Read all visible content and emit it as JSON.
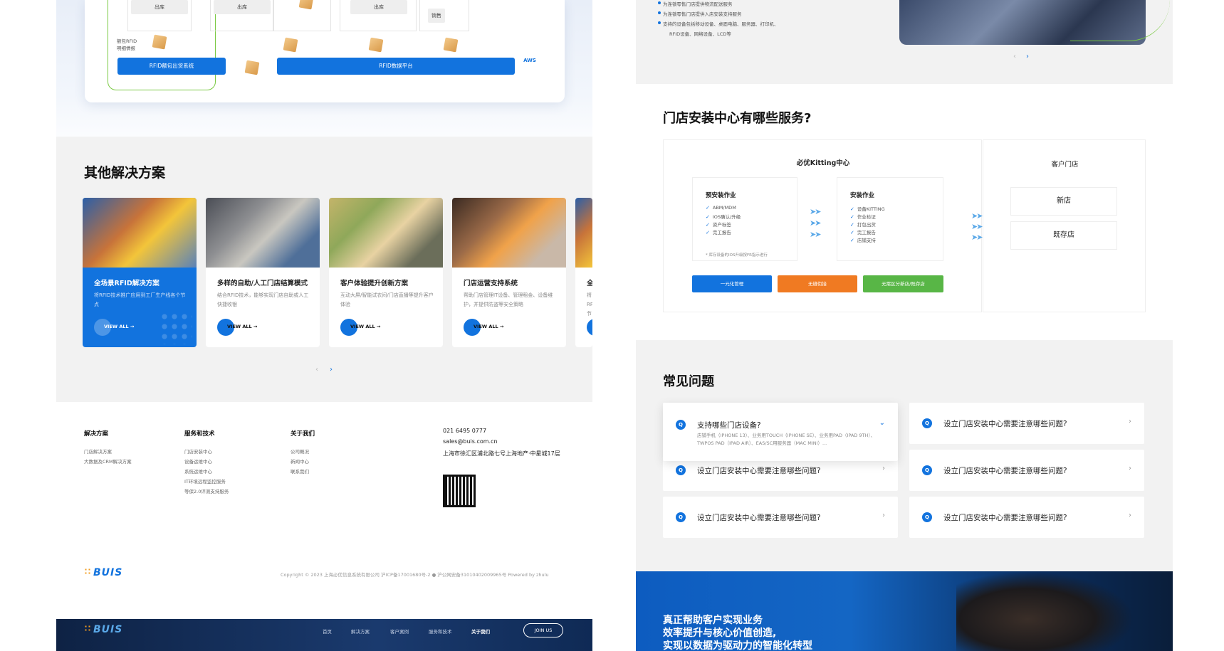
{
  "left": {
    "diagram": {
      "labels": [
        "出库",
        "出库",
        "出库",
        "销售"
      ],
      "side_note_1": "额包RFID",
      "side_note_2": "明细情报",
      "bar_left": "RFID额包出货系统",
      "bar_right": "RFID数据平台",
      "aws": "AWS"
    },
    "other_solutions": {
      "title": "其他解决方案",
      "view_all": "VIEW ALL",
      "prev": "‹",
      "next": "›",
      "cards": [
        {
          "title": "全场景RFID解决方案",
          "desc": "将RFID技术推广应用到工厂生产线各个节点"
        },
        {
          "title": "多样的自助/人工门店结算模式",
          "desc": "结合RFID技术，能够实现门店自助或人工快捷收银"
        },
        {
          "title": "客户体验提升创新方案",
          "desc": "互动大屏/智能试衣间/门店直播等提升客户体验"
        },
        {
          "title": "门店运营支持系统",
          "desc": "帮助门店管理IT设备、管理租金、设备维护，并提供防盗等安全策略"
        },
        {
          "title": "全",
          "desc": "将RFID节"
        }
      ]
    },
    "footer": {
      "col1": {
        "head": "解决方案",
        "items": [
          "门店解决方案",
          "大数据及CRM解决方案"
        ]
      },
      "col2": {
        "head": "服务和技术",
        "items": [
          "门店安装中心",
          "设备运维中心",
          "系统运维中心",
          "IT环境远程监控服务",
          "等保2.0评测支持服务"
        ]
      },
      "col3": {
        "head": "关于我们",
        "items": [
          "公司概况",
          "新闻中心",
          "联系我们"
        ]
      },
      "phone": "021 6495 0777",
      "email": "sales@buis.com.cn",
      "address": "上海市徐汇区浦北路七号上海地产·中星城17层",
      "logo": "BUIS",
      "copyright": "Copyright © 2023 上海必优信息系统有限公司 沪ICP备17001680号-2  ● 沪公网安备31010402009965号 Powered by zhulu"
    },
    "nav": {
      "logo": "BUIS",
      "items": [
        "首页",
        "解决方案",
        "客户案例",
        "服务和技术",
        "关于我们"
      ],
      "join": "JOIN US"
    }
  },
  "right": {
    "top_bullets": [
      "为连锁零售门店提供物流配送服务",
      "为连锁零售门店提供入店安装支持服务",
      "支持的设备包括移动设备、桌面电脑、服务器、打印机、",
      "RFID设备、网络设备、LCD等"
    ],
    "pager_prev": "‹",
    "pager_next": "›",
    "store_install": {
      "title": "门店安装中心有哪些服务?",
      "kitting_head": "必优Kitting中心",
      "pre_head": "预安装作业",
      "pre_items": [
        "ABM/MDM",
        "IOS确认/升级",
        "资产标签",
        "完工报告"
      ],
      "pre_note": "* 库存设备的IOS升级按FR指示进行",
      "install_head": "安装作业",
      "install_items": [
        "设备KITTING",
        "作业检证",
        "打包出货",
        "完工报告",
        "店铺支持"
      ],
      "btn1": "一元化管理",
      "btn2": "无缝衔接",
      "btn3": "无需区分新店/既存店",
      "btn_colors": [
        "#1273de",
        "#f07a22",
        "#58b646"
      ],
      "customer_head": "客户门店",
      "new_store": "新店",
      "existing_store": "既存店"
    },
    "faq": {
      "title": "常见问题",
      "q_icon": "Q",
      "items": [
        {
          "q": "支持哪些门店设备?",
          "a": "店铺手机（IPHONE 13）、业务用TOUCH（IPHONE SE）、业务用PAD（IPAD 9TH）、TWPOS PAD（IPAD AIR）、EAS/SC用服务器（MAC MINI）...",
          "open": true
        },
        {
          "q": "设立门店安装中心需要注意哪些问题?"
        },
        {
          "q": "设立门店安装中心需要注意哪些问题?"
        },
        {
          "q": "设立门店安装中心需要注意哪些问题?"
        },
        {
          "q": "设立门店安装中心需要注意哪些问题?"
        },
        {
          "q": "设立门店安装中心需要注意哪些问题?"
        }
      ]
    },
    "hero": {
      "line1": "真正帮助客户实现业务",
      "line2": "效率提升与核心价值创造,",
      "line3": "实现以数据为驱动力的智能化转型"
    }
  }
}
